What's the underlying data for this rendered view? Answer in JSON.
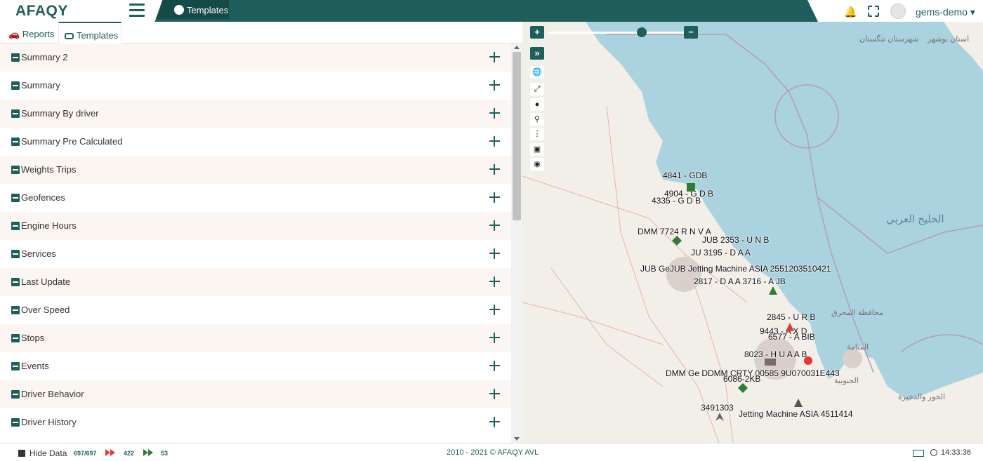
{
  "header": {
    "logo": "AFAQY",
    "active_tab": "Templates",
    "username": "gems-demo"
  },
  "subtabs": [
    "Reports",
    "Templates"
  ],
  "templates": [
    "Summary 2",
    "Summary",
    "Summary By driver",
    "Summary Pre Calculated",
    "Weights Trips",
    "Geofences",
    "Engine Hours",
    "Services",
    "Last Update",
    "Over Speed",
    "Stops",
    "Events",
    "Driver Behavior",
    "Driver History"
  ],
  "map": {
    "zoom_in": "+",
    "zoom_out": "−",
    "collapse": "»",
    "sea_label": "الخليج العربي",
    "arabic_labels": [
      "استان بوشهر",
      "شهرستان تنگستان",
      "محافظة المحرق",
      "المنامة",
      "الخور والذخيرة",
      "الجنوبية"
    ],
    "vehicle_labels": [
      "4841 - GDB",
      "4904 - G D B",
      "4335 - G D B",
      "DMM 7724 R N V A",
      "JUB 2353 - U N B",
      "JU 3195 - D A A",
      "JUB GeJUB Jetting Machine ASIA 2551203510421",
      "2817 - D A A 3716 - A JB",
      "2845 - U R B",
      "9443 - A X D",
      "6577 - A BIB",
      "8023 - H U A A B",
      "DMM Ge DDMM CRTY 00585 9U070031E443",
      "6086-2KB",
      "3491303",
      "Jetting Machine ASIA 4511414"
    ]
  },
  "footer": {
    "hide_data": "Hide Data",
    "units_count": "697/697",
    "moving_count": "422",
    "stopped_count": "53",
    "copyright": "2010 - 2021 © AFAQY AVL",
    "time": "14:33:36"
  },
  "colors": {
    "brand": "#1e5f5b",
    "row_alt": "#fbf6f1",
    "water": "#aad3df",
    "land": "#f2efe9"
  }
}
